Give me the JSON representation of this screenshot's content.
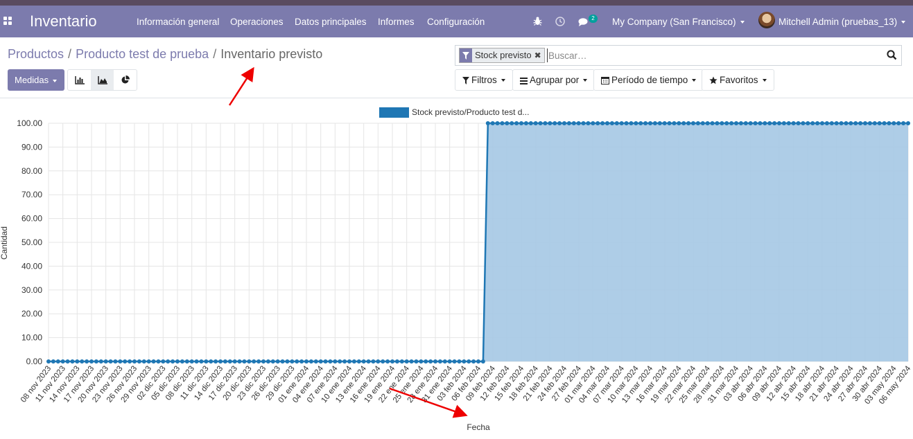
{
  "navbar": {
    "app_title": "Inventario",
    "menu": [
      "Información general",
      "Operaciones",
      "Datos principales",
      "Informes",
      "Configuración"
    ],
    "messages_count": "2",
    "company": "My Company (San Francisco)",
    "user": "Mitchell Admin (pruebas_13)"
  },
  "breadcrumb": [
    "Productos",
    "Producto test de prueba",
    "Inventario previsto"
  ],
  "buttons": {
    "measures": "Medidas",
    "filters": "Filtros",
    "group_by": "Agrupar por",
    "time_period": "Período de tiempo",
    "favorites": "Favoritos"
  },
  "search": {
    "facet": "Stock previsto",
    "placeholder": "Buscar…"
  },
  "colors": {
    "brand": "#7c7bad",
    "series": "#1f77b4",
    "fill": "#a5c8e4"
  },
  "icons": [
    "apps-icon",
    "bug-icon",
    "clock-icon",
    "chat-icon",
    "bar-chart-icon",
    "area-chart-icon",
    "pie-chart-icon",
    "filter-icon",
    "search-icon",
    "bars-icon",
    "calendar-icon",
    "star-icon"
  ],
  "chart_data": {
    "type": "area",
    "title": "",
    "xlabel": "Fecha",
    "ylabel": "Cantidad",
    "ylim": [
      0,
      100
    ],
    "yticks": [
      "0.00",
      "10.00",
      "20.00",
      "30.00",
      "40.00",
      "50.00",
      "60.00",
      "70.00",
      "80.00",
      "90.00",
      "100.00"
    ],
    "legend_position": "top",
    "grid": true,
    "x_tick_labels": [
      "08 nov 2023",
      "11 nov 2023",
      "14 nov 2023",
      "17 nov 2023",
      "20 nov 2023",
      "23 nov 2023",
      "26 nov 2023",
      "29 nov 2023",
      "02 dic 2023",
      "05 dic 2023",
      "08 dic 2023",
      "11 dic 2023",
      "14 dic 2023",
      "17 dic 2023",
      "20 dic 2023",
      "23 dic 2023",
      "26 dic 2023",
      "29 dic 2023",
      "01 ene 2024",
      "04 ene 2024",
      "07 ene 2024",
      "10 ene 2024",
      "13 ene 2024",
      "16 ene 2024",
      "19 ene 2024",
      "22 ene 2024",
      "25 ene 2024",
      "28 ene 2024",
      "31 ene 2024",
      "03 feb 2024",
      "06 feb 2024",
      "09 feb 2024",
      "12 feb 2024",
      "15 feb 2024",
      "18 feb 2024",
      "21 feb 2024",
      "24 feb 2024",
      "27 feb 2024",
      "01 mar 2024",
      "04 mar 2024",
      "07 mar 2024",
      "10 mar 2024",
      "13 mar 2024",
      "16 mar 2024",
      "19 mar 2024",
      "22 mar 2024",
      "25 mar 2024",
      "28 mar 2024",
      "31 mar 2024",
      "03 abr 2024",
      "06 abr 2024",
      "09 abr 2024",
      "12 abr 2024",
      "15 abr 2024",
      "18 abr 2024",
      "21 abr 2024",
      "24 abr 2024",
      "27 abr 2024",
      "30 abr 2024",
      "03 may 2024",
      "06 may 2024"
    ],
    "x_start": "2023-11-08",
    "x_end": "2024-05-06",
    "series": [
      {
        "name": "Stock previsto/Producto test d...",
        "steps": [
          {
            "from": "2023-11-08",
            "to": "2024-02-07",
            "value": 0
          },
          {
            "from": "2024-02-08",
            "to": "2024-05-06",
            "value": 100
          }
        ]
      }
    ]
  }
}
